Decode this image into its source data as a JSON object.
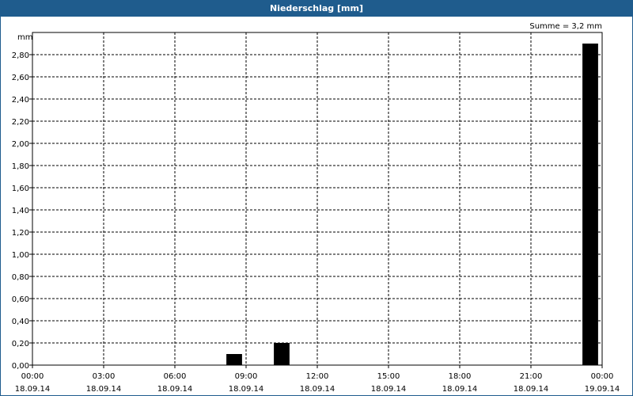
{
  "window": {
    "title": "Niederschlag [mm]"
  },
  "chart_data": {
    "type": "bar",
    "title": "Niederschlag [mm]",
    "ylabel": "mm",
    "annotation": "Summe = 3,2 mm",
    "ylim": [
      0,
      3.0
    ],
    "xlim_hours": [
      0,
      24
    ],
    "grid": true,
    "yticks": [
      "0,00",
      "0,20",
      "0,40",
      "0,60",
      "0,80",
      "1,00",
      "1,20",
      "1,40",
      "1,60",
      "1,80",
      "2,00",
      "2,20",
      "2,40",
      "2,60",
      "2,80"
    ],
    "xticks": [
      {
        "time": "00:00",
        "date": "18.09.14"
      },
      {
        "time": "03:00",
        "date": "18.09.14"
      },
      {
        "time": "06:00",
        "date": "18.09.14"
      },
      {
        "time": "09:00",
        "date": "18.09.14"
      },
      {
        "time": "12:00",
        "date": "18.09.14"
      },
      {
        "time": "15:00",
        "date": "18.09.14"
      },
      {
        "time": "18:00",
        "date": "18.09.14"
      },
      {
        "time": "21:00",
        "date": "18.09.14"
      },
      {
        "time": "00:00",
        "date": "19.09.14"
      }
    ],
    "series": [
      {
        "bars": [
          {
            "time": "08:30",
            "value": 0.1
          },
          {
            "time": "10:30",
            "value": 0.2
          },
          {
            "time": "23:30",
            "value": 2.9
          }
        ]
      }
    ]
  }
}
